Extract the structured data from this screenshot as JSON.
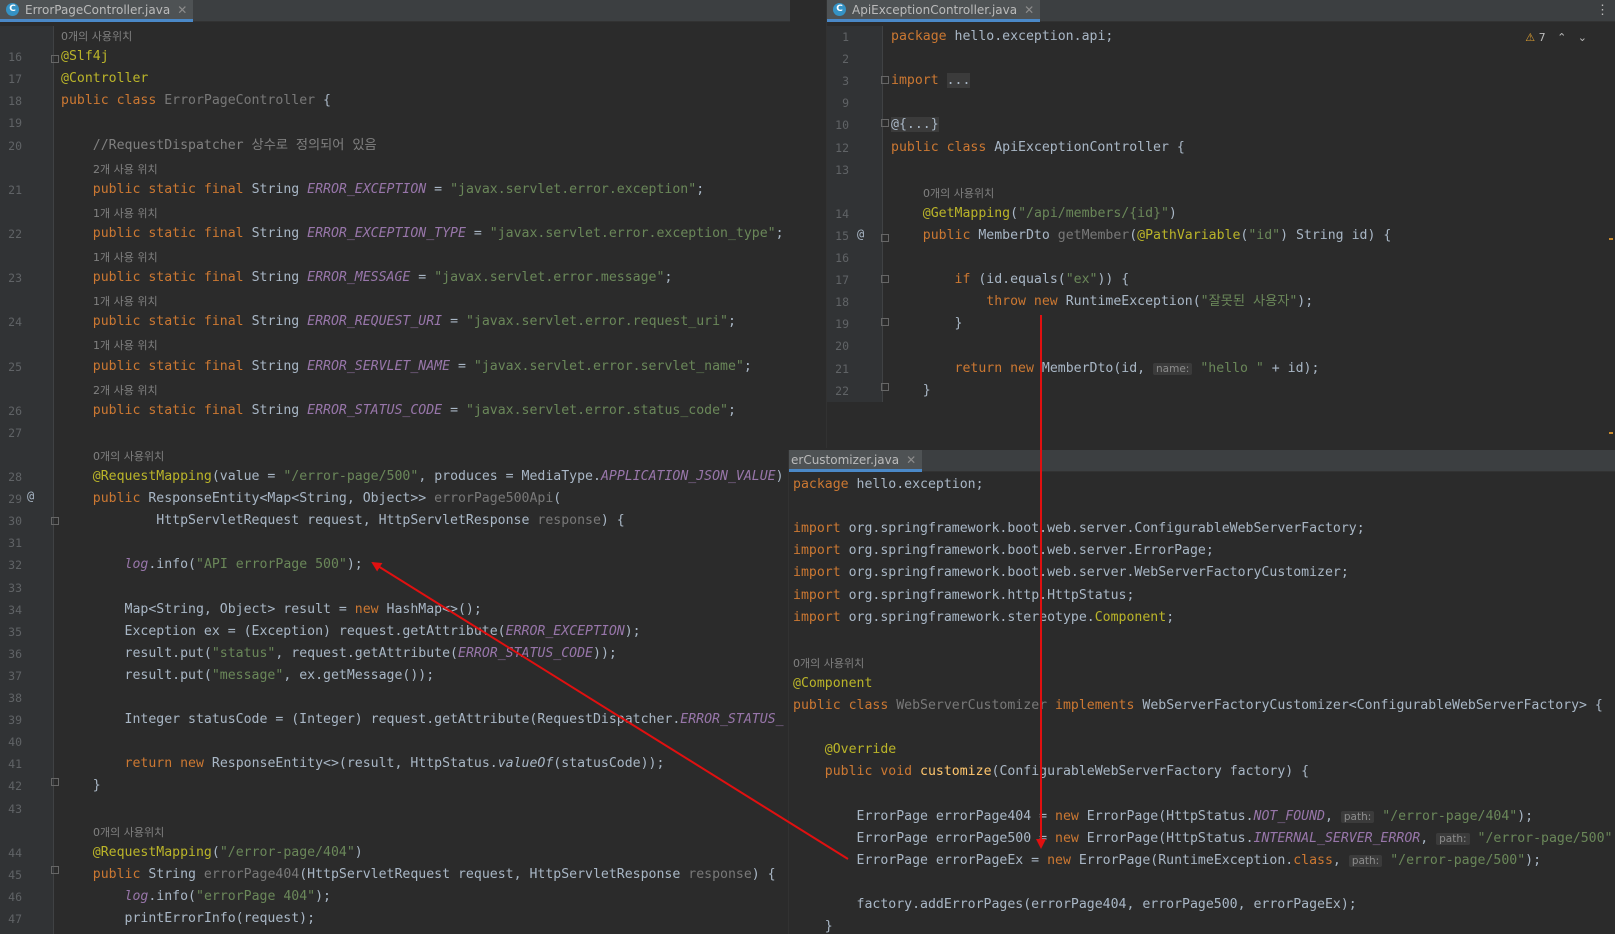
{
  "left_pane": {
    "tab": "ErrorPageController.java",
    "lines": [
      {
        "no": "",
        "hint": "0개의 사용위치"
      },
      {
        "no": "16",
        "html": "<span class=\"an\">@Slf4j</span>"
      },
      {
        "no": "17",
        "html": "<span class=\"an\">@Controller</span>"
      },
      {
        "no": "18",
        "html": "<span class=\"kw\">public class </span><span class=\"gray\">ErrorPageController</span> {"
      },
      {
        "no": "19",
        "html": ""
      },
      {
        "no": "20",
        "html": "    <span class=\"cm\">//RequestDispatcher 상수로 정의되어 있음</span>"
      },
      {
        "no": "",
        "hint": "2개 사용 위치"
      },
      {
        "no": "21",
        "html": "    <span class=\"kw\">public static final </span>String <span class=\"fld\">ERROR_EXCEPTION</span> = <span class=\"str\">\"javax.servlet.error.exception\"</span>;"
      },
      {
        "no": "",
        "hint": "1개 사용 위치"
      },
      {
        "no": "22",
        "html": "    <span class=\"kw\">public static final </span>String <span class=\"fld\">ERROR_EXCEPTION_TYPE</span> = <span class=\"str\">\"javax.servlet.error.exception_type\"</span>;"
      },
      {
        "no": "",
        "hint": "1개 사용 위치"
      },
      {
        "no": "23",
        "html": "    <span class=\"kw\">public static final </span>String <span class=\"fld\">ERROR_MESSAGE</span> = <span class=\"str\">\"javax.servlet.error.message\"</span>;"
      },
      {
        "no": "",
        "hint": "1개 사용 위치"
      },
      {
        "no": "24",
        "html": "    <span class=\"kw\">public static final </span>String <span class=\"fld\">ERROR_REQUEST_URI</span> = <span class=\"str\">\"javax.servlet.error.request_uri\"</span>;"
      },
      {
        "no": "",
        "hint": "1개 사용 위치"
      },
      {
        "no": "25",
        "html": "    <span class=\"kw\">public static final </span>String <span class=\"fld\">ERROR_SERVLET_NAME</span> = <span class=\"str\">\"javax.servlet.error.servlet_name\"</span>;"
      },
      {
        "no": "",
        "hint": "2개 사용 위치"
      },
      {
        "no": "26",
        "html": "    <span class=\"kw\">public static final </span>String <span class=\"fld\">ERROR_STATUS_CODE</span> = <span class=\"str\">\"javax.servlet.error.status_code\"</span>;"
      },
      {
        "no": "27",
        "html": ""
      },
      {
        "no": "",
        "hint": "0개의 사용위치"
      },
      {
        "no": "28",
        "html": "    <span class=\"an\">@RequestMapping</span>(value = <span class=\"str\">\"/error-page/500\"</span>, produces = MediaType.<span class=\"fld\">APPLICATION_JSON_VALUE</span>)"
      },
      {
        "no": "29",
        "html": "    <span class=\"kw\">public </span>ResponseEntity&lt;Map&lt;String, Object&gt;&gt; <span class=\"gray\">errorPage500Api</span>("
      },
      {
        "no": "30",
        "html": "            HttpServletRequest request, HttpServletResponse <span class=\"gray\">response</span>) {"
      },
      {
        "no": "31",
        "html": ""
      },
      {
        "no": "32",
        "html": "        <span class=\"fld\">log</span>.info(<span class=\"str\">\"API errorPage 500\"</span>);"
      },
      {
        "no": "33",
        "html": ""
      },
      {
        "no": "34",
        "html": "        Map&lt;String, Object&gt; result = <span class=\"kw\">new </span>HashMap&lt;&gt;();"
      },
      {
        "no": "35",
        "html": "        Exception ex = (Exception) request.getAttribute(<span class=\"fld\">ERROR_EXCEPTION</span>);"
      },
      {
        "no": "36",
        "html": "        result.put(<span class=\"str\">\"status\"</span>, request.getAttribute(<span class=\"fld\">ERROR_STATUS_CODE</span>));"
      },
      {
        "no": "37",
        "html": "        result.put(<span class=\"str\">\"message\"</span>, ex.getMessage());"
      },
      {
        "no": "38",
        "html": ""
      },
      {
        "no": "39",
        "html": "        Integer statusCode = (Integer) request.getAttribute(RequestDispatcher.<span class=\"fld\">ERROR_STATUS_</span>"
      },
      {
        "no": "40",
        "html": ""
      },
      {
        "no": "41",
        "html": "        <span class=\"kw\">return new </span>ResponseEntity&lt;&gt;(result, HttpStatus.<span style=\"font-style:italic\">valueOf</span>(statusCode));"
      },
      {
        "no": "42",
        "html": "    }"
      },
      {
        "no": "43",
        "html": ""
      },
      {
        "no": "",
        "hint": "0개의 사용위치"
      },
      {
        "no": "44",
        "html": "    <span class=\"an\">@RequestMapping</span>(<span class=\"str\">\"/error-page/404\"</span>)"
      },
      {
        "no": "45",
        "html": "    <span class=\"kw\">public </span>String <span class=\"gray\">errorPage404</span>(HttpServletRequest request, HttpServletResponse <span class=\"gray\">response</span>) {"
      },
      {
        "no": "46",
        "html": "        <span class=\"fld\">log</span>.info(<span class=\"str\">\"errorPage 404\"</span>);"
      },
      {
        "no": "47",
        "html": "        printErrorInfo(request);"
      }
    ]
  },
  "right_top_pane": {
    "tab": "ApiExceptionController.java",
    "warnings": "7",
    "lines": [
      {
        "no": "1",
        "html": "<span class=\"kw\">package </span>hello.exception.api;"
      },
      {
        "no": "2",
        "html": ""
      },
      {
        "no": "3",
        "html": "<span class=\"kw\">import </span><span style=\"background:#3b3b3b\">...</span>"
      },
      {
        "no": "9",
        "html": ""
      },
      {
        "no": "10",
        "html": "<span style=\"background:#3b3b3b\">@{...}</span>"
      },
      {
        "no": "12",
        "html": "<span class=\"kw\">public class </span>ApiExceptionController {"
      },
      {
        "no": "13",
        "html": ""
      },
      {
        "no": "",
        "hint": "0개의 사용위치"
      },
      {
        "no": "14",
        "html": "    <span class=\"an\">@GetMapping</span>(<span class=\"str\">\"/api/members/{id}\"</span>)"
      },
      {
        "no": "15",
        "html": "    <span class=\"kw\">public </span>MemberDto <span class=\"gray\">getMember</span>(<span class=\"an\">@PathVariable</span>(<span class=\"str\">\"id\"</span>) String id) {"
      },
      {
        "no": "16",
        "html": ""
      },
      {
        "no": "17",
        "html": "        <span class=\"kw\">if </span>(id.equals(<span class=\"str\">\"ex\"</span>)) {"
      },
      {
        "no": "18",
        "html": "            <span class=\"kw\">throw new </span>RuntimeException(<span class=\"str\">\"잘못된 사용자\"</span>);"
      },
      {
        "no": "19",
        "html": "        }"
      },
      {
        "no": "20",
        "html": ""
      },
      {
        "no": "21",
        "html": "        <span class=\"kw\">return new </span>MemberDto(id, <span class=\"pn\">name:</span> <span class=\"str\">\"hello \"</span> + id);"
      },
      {
        "no": "22",
        "html": "    }"
      }
    ]
  },
  "right_bottom_pane": {
    "tab": "erCustomizer.java",
    "lines": [
      {
        "html": "<span class=\"kw\">package </span>hello.exception;"
      },
      {
        "html": ""
      },
      {
        "html": "<span class=\"kw\">import </span>org.springframework.boot.web.server.ConfigurableWebServerFactory;"
      },
      {
        "html": "<span class=\"kw\">import </span>org.springframework.boot.web.server.ErrorPage;"
      },
      {
        "html": "<span class=\"kw\">import </span>org.springframework.boot.web.server.WebServerFactoryCustomizer;"
      },
      {
        "html": "<span class=\"kw\">import </span>org.springframework.http.HttpStatus;"
      },
      {
        "html": "<span class=\"kw\">import </span>org.springframework.stereotype.<span class=\"an\">Component</span>;"
      },
      {
        "html": ""
      },
      {
        "hint": "0개의 사용위치"
      },
      {
        "html": "<span class=\"an\">@Component</span>"
      },
      {
        "html": "<span class=\"kw\">public class </span><span class=\"gray\">WebServerCustomizer</span> <span class=\"kw\">implements </span>WebServerFactoryCustomizer&lt;ConfigurableWebServerFactory&gt; {"
      },
      {
        "html": ""
      },
      {
        "html": "    <span class=\"an\">@Override</span>"
      },
      {
        "html": "    <span class=\"kw\">public void </span><span class=\"mth\">customize</span>(ConfigurableWebServerFactory factory) {"
      },
      {
        "html": ""
      },
      {
        "html": "        ErrorPage errorPage404 = <span class=\"kw\">new </span>ErrorPage(HttpStatus.<span class=\"fld\">NOT_FOUND</span>, <span class=\"pn\">path:</span> <span class=\"str\">\"/error-page/404\"</span>);"
      },
      {
        "html": "        ErrorPage errorPage500 = <span class=\"kw\">new </span>ErrorPage(HttpStatus.<span class=\"fld\">INTERNAL_SERVER_ERROR</span>, <span class=\"pn\">path:</span> <span class=\"str\">\"/error-page/500\"</span>"
      },
      {
        "html": "        ErrorPage errorPageEx = <span class=\"kw\">new </span>ErrorPage(RuntimeException.<span class=\"kw\">class</span>, <span class=\"pn\">path:</span> <span class=\"str\">\"/error-page/500\"</span>);"
      },
      {
        "html": ""
      },
      {
        "html": "        factory.addErrorPages(errorPage404, errorPage500, errorPageEx);"
      },
      {
        "html": "    }"
      }
    ]
  },
  "colors": {
    "arrow": "#e01010",
    "background": "#2b2b2b",
    "keyword": "#cc7832",
    "string": "#6a8759",
    "annotation": "#bbb529",
    "field": "#9876aa"
  }
}
